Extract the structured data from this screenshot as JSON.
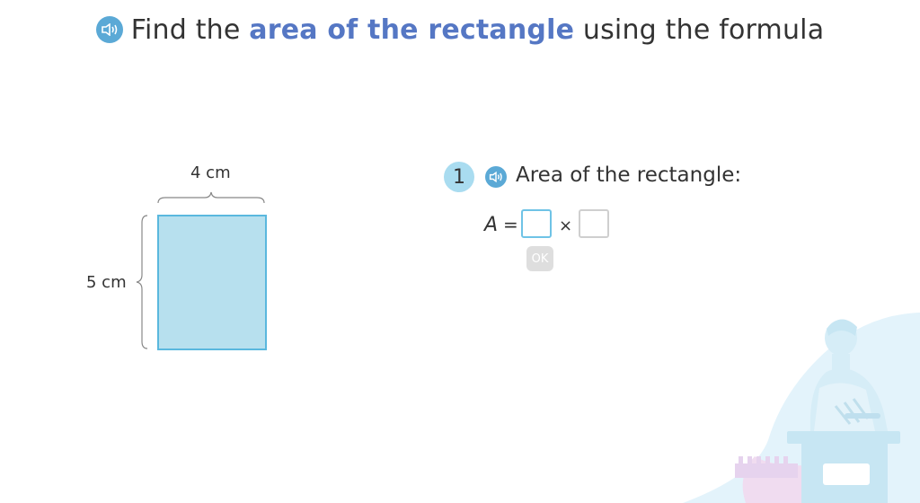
{
  "header": {
    "prefix": "Find the",
    "highlight": "area of the rectangle",
    "suffix": "using the formula"
  },
  "figure": {
    "width_label": "4 cm",
    "height_label": "5 cm"
  },
  "step": {
    "number": "1",
    "label": "Area of the rectangle:"
  },
  "equation": {
    "variable": "A",
    "equals": "=",
    "operator": "×",
    "input1_value": "",
    "input2_value": ""
  },
  "ok_button": {
    "label": "OK",
    "state": "disabled"
  },
  "icons": {
    "title_audio": "speaker-icon",
    "step_audio": "speaker-icon"
  },
  "colors": {
    "accent": "#5577c4",
    "audio": "#5ba9d6",
    "rect_fill": "#b7e0ee",
    "rect_stroke": "#5ab8de"
  }
}
